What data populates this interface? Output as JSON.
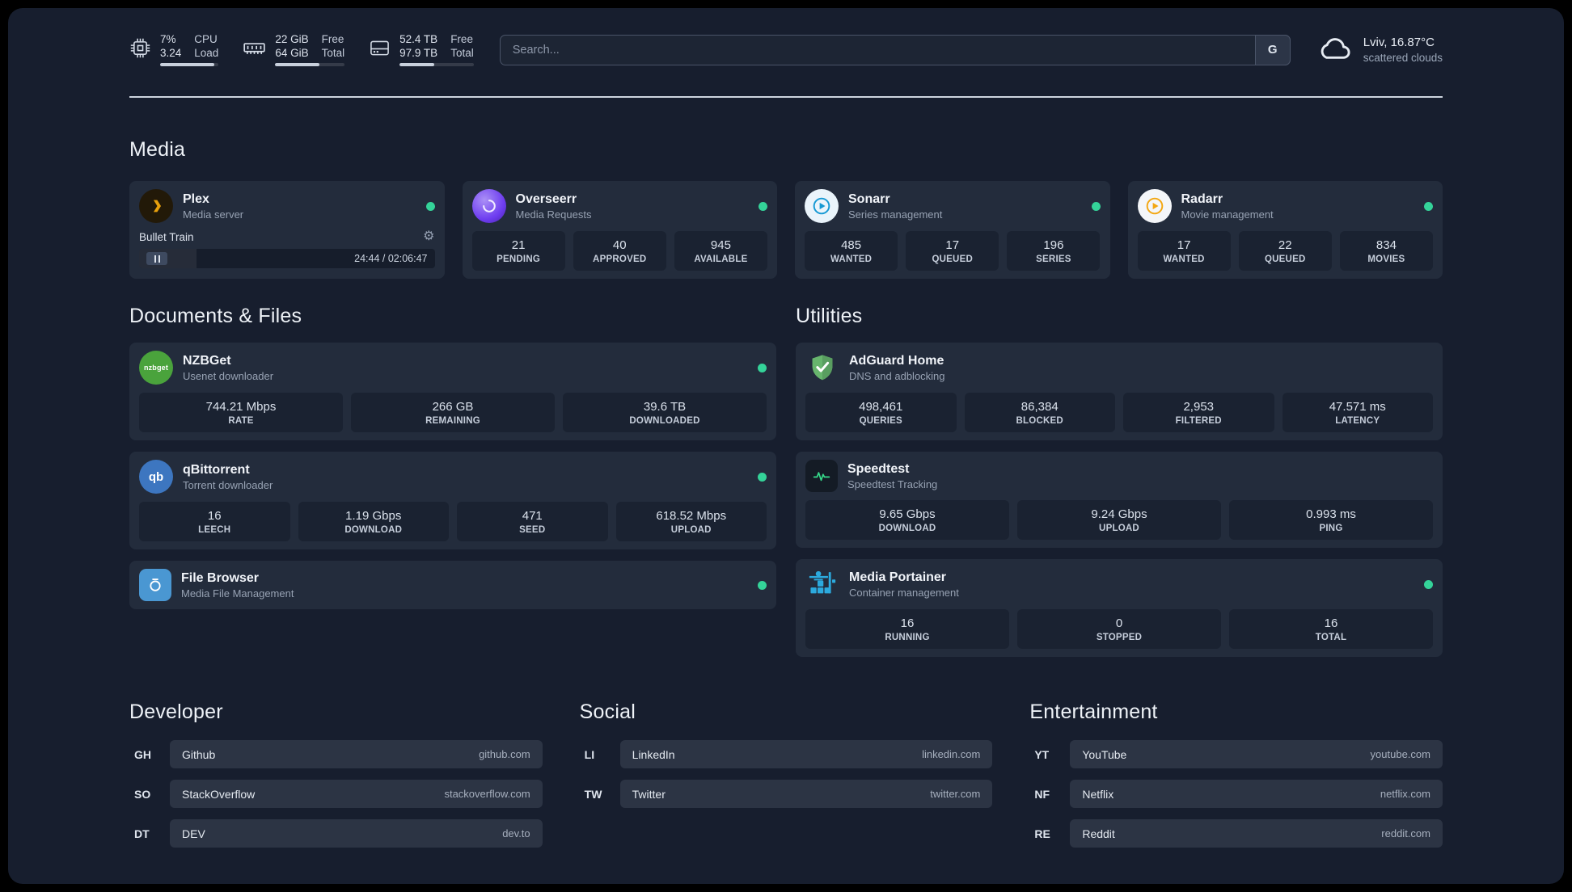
{
  "colors": {
    "status_online": "#34d399"
  },
  "topbar": {
    "resources": [
      {
        "widget": "cpu-widget",
        "icon": "cpu-icon",
        "value_top": "7%",
        "value_bottom": "3.24",
        "label_top": "CPU",
        "label_bottom": "Load",
        "bar_percent": 92
      },
      {
        "widget": "memory-widget",
        "icon": "memory-icon",
        "value_top": "22 GiB",
        "value_bottom": "64 GiB",
        "label_top": "Free",
        "label_bottom": "Total",
        "bar_percent": 64
      },
      {
        "widget": "disk-widget",
        "icon": "disk-icon",
        "value_top": "52.4 TB",
        "value_bottom": "97.9 TB",
        "label_top": "Free",
        "label_bottom": "Total",
        "bar_percent": 47
      }
    ],
    "search": {
      "placeholder": "Search...",
      "provider_label": "G"
    },
    "weather": {
      "icon": "cloud-icon",
      "location": "Lviv, 16.87°C",
      "condition": "scattered clouds"
    }
  },
  "groups": [
    {
      "title": "Media",
      "services": [
        {
          "name": "Plex",
          "subtitle": "Media server",
          "icon": "plex-icon",
          "online": true,
          "player": {
            "track": "Bullet Train",
            "time": "24:44 / 02:06:47",
            "progress_percent": 19.5
          }
        },
        {
          "name": "Overseerr",
          "subtitle": "Media Requests",
          "icon": "overseerr-icon",
          "online": true,
          "stats": [
            {
              "value": "21",
              "label": "PENDING"
            },
            {
              "value": "40",
              "label": "APPROVED"
            },
            {
              "value": "945",
              "label": "AVAILABLE"
            }
          ]
        },
        {
          "name": "Sonarr",
          "subtitle": "Series management",
          "icon": "sonarr-icon",
          "online": true,
          "stats": [
            {
              "value": "485",
              "label": "WANTED"
            },
            {
              "value": "17",
              "label": "QUEUED"
            },
            {
              "value": "196",
              "label": "SERIES"
            }
          ]
        },
        {
          "name": "Radarr",
          "subtitle": "Movie management",
          "icon": "radarr-icon",
          "online": true,
          "stats": [
            {
              "value": "17",
              "label": "WANTED"
            },
            {
              "value": "22",
              "label": "QUEUED"
            },
            {
              "value": "834",
              "label": "MOVIES"
            }
          ]
        }
      ]
    },
    {
      "title": "Documents & Files",
      "services": [
        {
          "name": "NZBGet",
          "subtitle": "Usenet downloader",
          "icon": "nzbget-icon",
          "online": true,
          "stats": [
            {
              "value": "744.21 Mbps",
              "label": "RATE"
            },
            {
              "value": "266 GB",
              "label": "REMAINING"
            },
            {
              "value": "39.6 TB",
              "label": "DOWNLOADED"
            }
          ]
        },
        {
          "name": "qBittorrent",
          "subtitle": "Torrent downloader",
          "icon": "qbittorrent-icon",
          "online": true,
          "stats": [
            {
              "value": "16",
              "label": "LEECH"
            },
            {
              "value": "1.19 Gbps",
              "label": "DOWNLOAD"
            },
            {
              "value": "471",
              "label": "SEED"
            },
            {
              "value": "618.52 Mbps",
              "label": "UPLOAD"
            }
          ]
        },
        {
          "name": "File Browser",
          "subtitle": "Media File Management",
          "icon": "filebrowser-icon",
          "online": true,
          "stats": []
        }
      ]
    },
    {
      "title": "Utilities",
      "services": [
        {
          "name": "AdGuard Home",
          "subtitle": "DNS and adblocking",
          "icon": "adguard-icon",
          "online": false,
          "stats": [
            {
              "value": "498,461",
              "label": "QUERIES"
            },
            {
              "value": "86,384",
              "label": "BLOCKED"
            },
            {
              "value": "2,953",
              "label": "FILTERED"
            },
            {
              "value": "47.571 ms",
              "label": "LATENCY"
            }
          ]
        },
        {
          "name": "Speedtest",
          "subtitle": "Speedtest Tracking",
          "icon": "speedtest-icon",
          "online": false,
          "stats": [
            {
              "value": "9.65 Gbps",
              "label": "DOWNLOAD"
            },
            {
              "value": "9.24 Gbps",
              "label": "UPLOAD"
            },
            {
              "value": "0.993 ms",
              "label": "PING"
            }
          ]
        },
        {
          "name": "Media Portainer",
          "subtitle": "Container management",
          "icon": "portainer-icon",
          "online": true,
          "stats": [
            {
              "value": "16",
              "label": "RUNNING"
            },
            {
              "value": "0",
              "label": "STOPPED"
            },
            {
              "value": "16",
              "label": "TOTAL"
            }
          ]
        }
      ]
    }
  ],
  "bookmarks": [
    {
      "title": "Developer",
      "items": [
        {
          "abbr": "GH",
          "name": "Github",
          "url": "github.com"
        },
        {
          "abbr": "SO",
          "name": "StackOverflow",
          "url": "stackoverflow.com"
        },
        {
          "abbr": "DT",
          "name": "DEV",
          "url": "dev.to"
        }
      ]
    },
    {
      "title": "Social",
      "items": [
        {
          "abbr": "LI",
          "name": "LinkedIn",
          "url": "linkedin.com"
        },
        {
          "abbr": "TW",
          "name": "Twitter",
          "url": "twitter.com"
        }
      ]
    },
    {
      "title": "Entertainment",
      "items": [
        {
          "abbr": "YT",
          "name": "YouTube",
          "url": "youtube.com"
        },
        {
          "abbr": "NF",
          "name": "Netflix",
          "url": "netflix.com"
        },
        {
          "abbr": "RE",
          "name": "Reddit",
          "url": "reddit.com"
        }
      ]
    }
  ]
}
